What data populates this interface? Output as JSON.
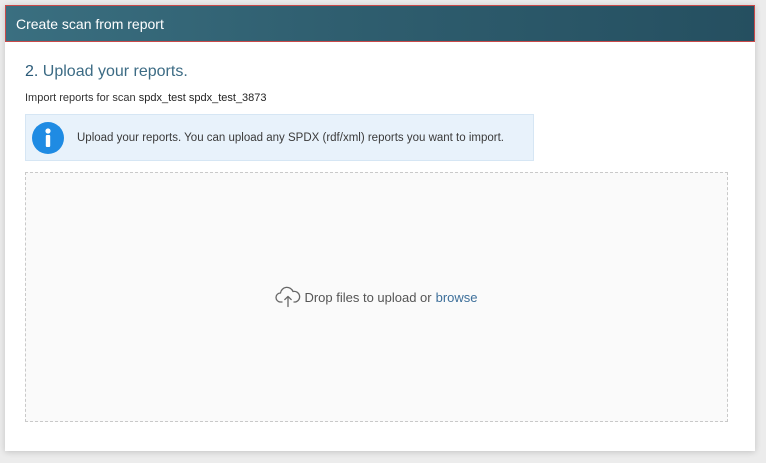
{
  "dialog": {
    "title": "Create scan from report"
  },
  "step": {
    "number": "2.",
    "title": "Upload your reports."
  },
  "import_line": {
    "prefix": "Import reports for scan",
    "scan_name": "spdx_test spdx_test_3873"
  },
  "info": {
    "icon": "info-icon",
    "text": "Upload your reports. You can upload any SPDX (rdf/xml) reports you want to import."
  },
  "dropzone": {
    "icon": "cloud-upload-icon",
    "text": "Drop files to upload or",
    "browse_label": "browse"
  },
  "colors": {
    "header_bg": "#2f5e6f",
    "accent_blue": "#1f8be3",
    "link": "#3d6f9a",
    "step_title": "#3c6b84"
  }
}
